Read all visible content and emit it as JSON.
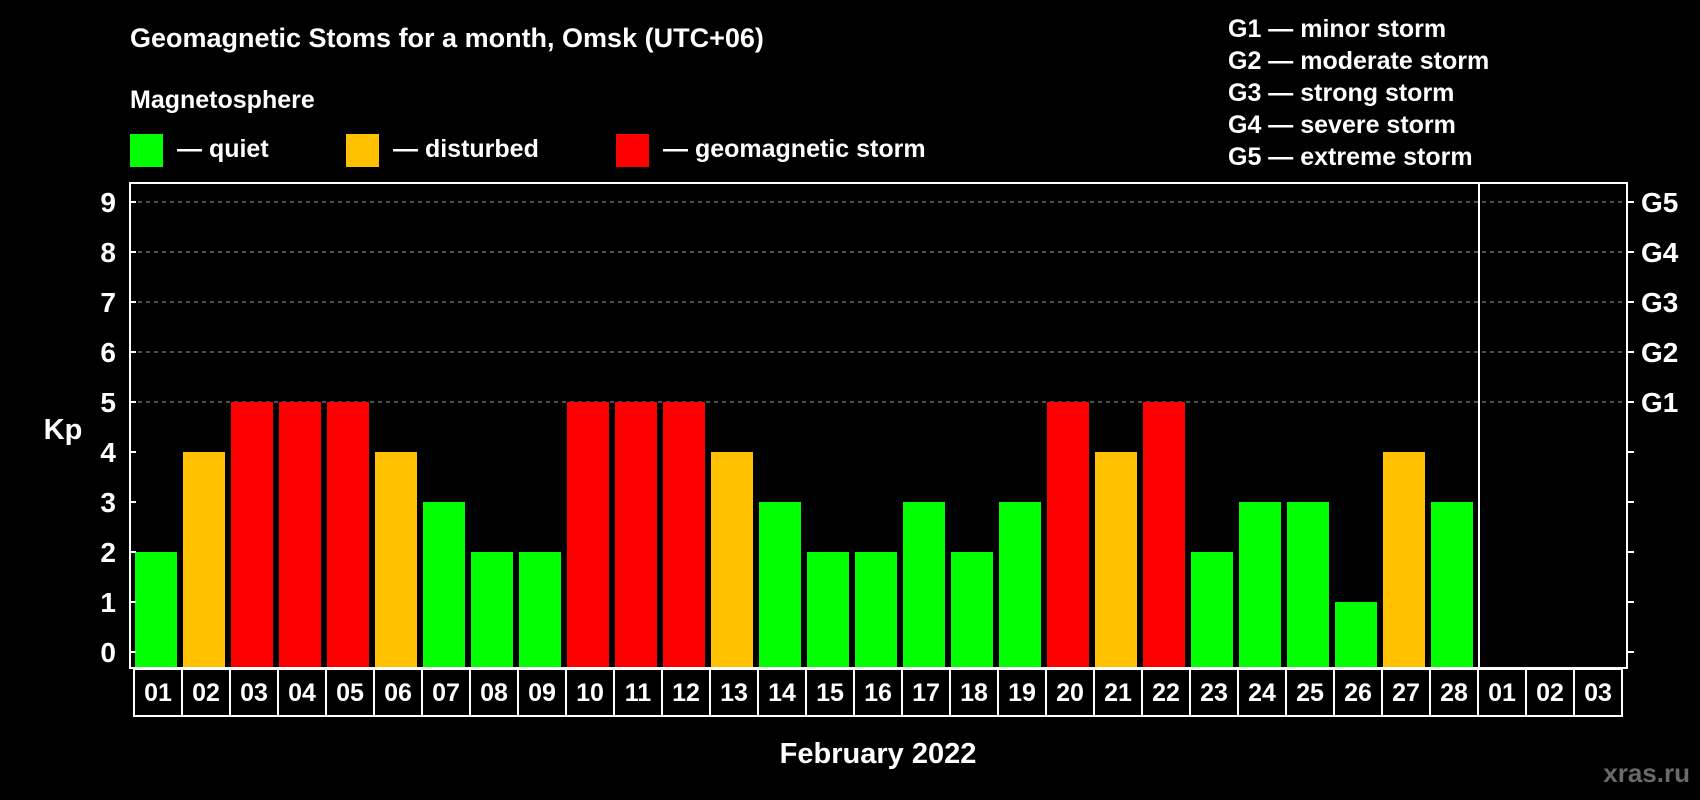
{
  "chart_data": {
    "type": "bar",
    "title": "Geomagnetic Stoms for a month, Omsk (UTC+06)",
    "legend_title": "Magnetosphere",
    "legend": [
      {
        "label": "— quiet",
        "color": "#00ff00"
      },
      {
        "label": "— disturbed",
        "color": "#ffc000"
      },
      {
        "label": "— geomagnetic storm",
        "color": "#ff0000"
      }
    ],
    "storm_scale": [
      "G1 — minor storm",
      "G2 — moderate storm",
      "G3 — strong storm",
      "G4 — severe storm",
      "G5 — extreme storm"
    ],
    "ylabel": "Kp",
    "xlabel": "February 2022",
    "ylim": [
      0,
      9
    ],
    "yticks": [
      "0",
      "1",
      "2",
      "3",
      "4",
      "5",
      "6",
      "7",
      "8",
      "9"
    ],
    "right_ticks": [
      {
        "kp": 5,
        "label": "G1"
      },
      {
        "kp": 6,
        "label": "G2"
      },
      {
        "kp": 7,
        "label": "G3"
      },
      {
        "kp": 8,
        "label": "G4"
      },
      {
        "kp": 9,
        "label": "G5"
      }
    ],
    "categories": [
      "01",
      "02",
      "03",
      "04",
      "05",
      "06",
      "07",
      "08",
      "09",
      "10",
      "11",
      "12",
      "13",
      "14",
      "15",
      "16",
      "17",
      "18",
      "19",
      "20",
      "21",
      "22",
      "23",
      "24",
      "25",
      "26",
      "27",
      "28",
      "01",
      "02",
      "03"
    ],
    "values": [
      2,
      4,
      5,
      5,
      5,
      4,
      3,
      2,
      2,
      5,
      5,
      5,
      4,
      3,
      2,
      2,
      3,
      2,
      3,
      5,
      4,
      5,
      2,
      3,
      3,
      1,
      4,
      3,
      null,
      null,
      null
    ],
    "colors": {
      "quiet": "#00ff00",
      "disturbed": "#ffc000",
      "storm": "#ff0000"
    },
    "grid": "dashed horizontal at Kp 5–9",
    "watermark": "xras.ru"
  }
}
